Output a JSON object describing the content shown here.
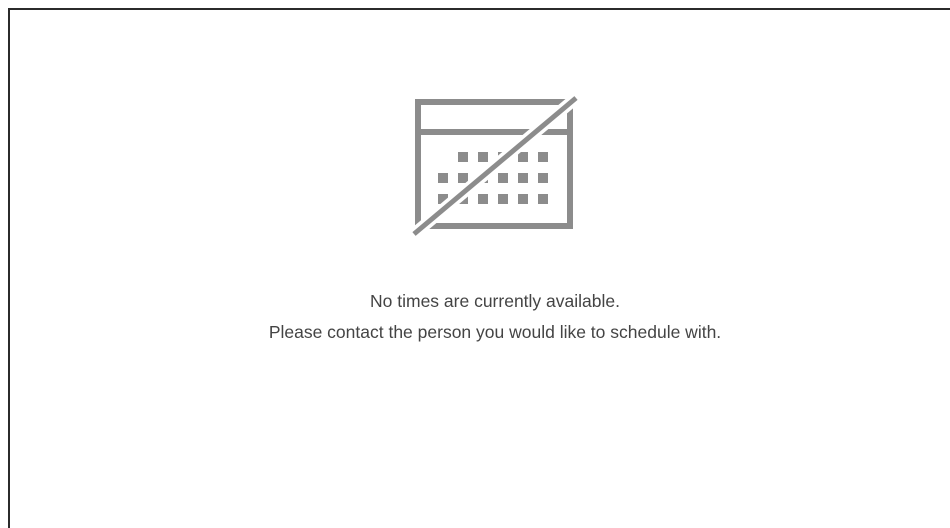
{
  "empty_state": {
    "icon": "calendar-slash-icon",
    "icon_color": "#8c8c8c",
    "line1": "No times are currently available.",
    "line2": "Please contact the person you would like to schedule with."
  }
}
